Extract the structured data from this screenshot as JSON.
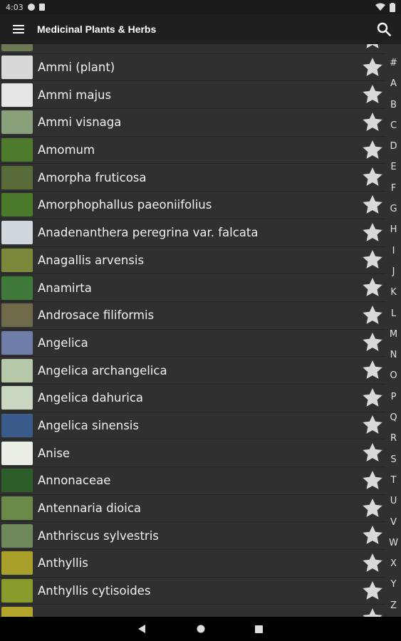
{
  "status": {
    "time": "4:03"
  },
  "toolbar": {
    "title": "Medicinal Plants & Herbs"
  },
  "rows": [
    {
      "name": "Ammi (plant)",
      "thumb_color": "#d8d8d8"
    },
    {
      "name": "Ammi majus",
      "thumb_color": "#e6e6e6"
    },
    {
      "name": "Ammi visnaga",
      "thumb_color": "#8aa07a"
    },
    {
      "name": "Amomum",
      "thumb_color": "#4e7a2e"
    },
    {
      "name": "Amorpha fruticosa",
      "thumb_color": "#5a6b3a"
    },
    {
      "name": "Amorphophallus paeoniifolius",
      "thumb_color": "#4b7a2c"
    },
    {
      "name": "Anadenanthera peregrina var. falcata",
      "thumb_color": "#cfd6dc"
    },
    {
      "name": "Anagallis arvensis",
      "thumb_color": "#7a8a3a"
    },
    {
      "name": "Anamirta",
      "thumb_color": "#3f7a3a"
    },
    {
      "name": "Androsace filiformis",
      "thumb_color": "#6e6a4a"
    },
    {
      "name": "Angelica",
      "thumb_color": "#6e7ea8"
    },
    {
      "name": "Angelica archangelica",
      "thumb_color": "#b6c8a8"
    },
    {
      "name": "Angelica dahurica",
      "thumb_color": "#c9d6c0"
    },
    {
      "name": "Angelica sinensis",
      "thumb_color": "#3a5a8a"
    },
    {
      "name": "Anise",
      "thumb_color": "#e9efe4"
    },
    {
      "name": "Annonaceae",
      "thumb_color": "#2d5e2a"
    },
    {
      "name": "Antennaria dioica",
      "thumb_color": "#6a8a4a"
    },
    {
      "name": "Anthriscus sylvestris",
      "thumb_color": "#6f8a5a"
    },
    {
      "name": "Anthyllis",
      "thumb_color": "#a8a02a"
    },
    {
      "name": "Anthyllis cytisoides",
      "thumb_color": "#8a9a2a"
    }
  ],
  "index_letters": [
    "#",
    "A",
    "B",
    "C",
    "D",
    "E",
    "F",
    "G",
    "H",
    "I",
    "J",
    "K",
    "L",
    "M",
    "N",
    "O",
    "P",
    "Q",
    "R",
    "S",
    "T",
    "U",
    "V",
    "W",
    "X",
    "Y",
    "Z"
  ]
}
